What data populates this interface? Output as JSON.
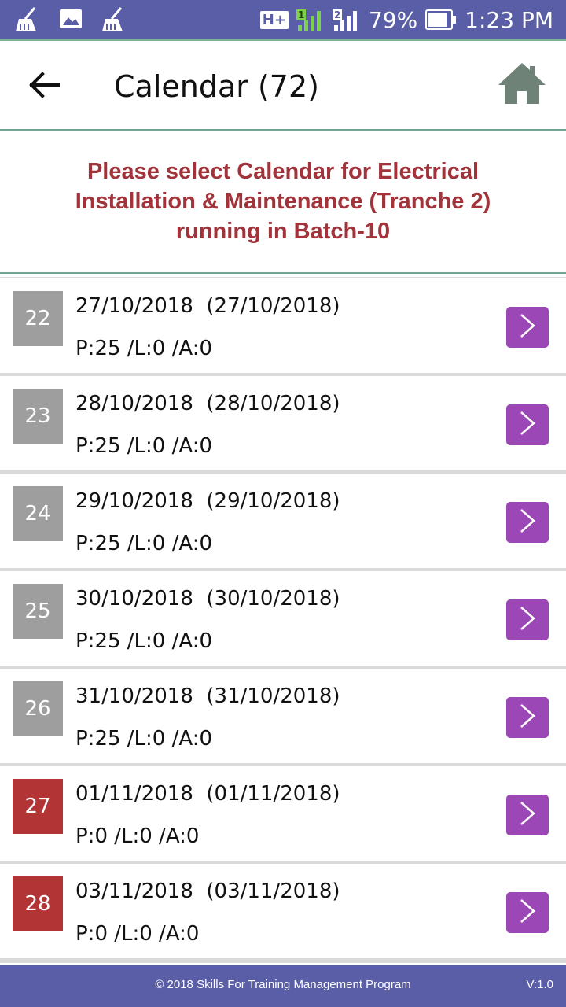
{
  "status_bar": {
    "battery": "79%",
    "time": "1:23 PM",
    "network_type": "H+",
    "sim1": "1",
    "sim2": "2",
    "icons": [
      "broom-icon",
      "image-icon",
      "broom-icon",
      "signal-icon",
      "battery-icon"
    ]
  },
  "header": {
    "title": "Calendar (72)",
    "back_icon": "arrow-left-icon",
    "home_icon": "home-icon"
  },
  "banner": {
    "text": "Please select Calendar for Electrical\nInstallation & Maintenance  (Tranche 2)\nrunning in Batch-10"
  },
  "colors": {
    "status_bar": "#5a5ea6",
    "banner_text": "#a2333a",
    "badge_past": "#9e9e9e",
    "badge_missed": "#b23434",
    "go_button": "#9b47b5"
  },
  "calendar": [
    {
      "day": "22",
      "date": "27/10/2018  (27/10/2018)",
      "stats": "P:25 /L:0 /A:0",
      "status": "past"
    },
    {
      "day": "23",
      "date": "28/10/2018  (28/10/2018)",
      "stats": "P:25 /L:0 /A:0",
      "status": "past"
    },
    {
      "day": "24",
      "date": "29/10/2018  (29/10/2018)",
      "stats": "P:25 /L:0 /A:0",
      "status": "past"
    },
    {
      "day": "25",
      "date": "30/10/2018  (30/10/2018)",
      "stats": "P:25 /L:0 /A:0",
      "status": "past"
    },
    {
      "day": "26",
      "date": "31/10/2018  (31/10/2018)",
      "stats": "P:25 /L:0 /A:0",
      "status": "past"
    },
    {
      "day": "27",
      "date": "01/11/2018  (01/11/2018)",
      "stats": "P:0 /L:0 /A:0",
      "status": "missed"
    },
    {
      "day": "28",
      "date": "03/11/2018  (03/11/2018)",
      "stats": "P:0 /L:0 /A:0",
      "status": "missed"
    }
  ],
  "footer": {
    "copyright": "© 2018 Skills For Training Management Program",
    "version": "V:1.0"
  }
}
